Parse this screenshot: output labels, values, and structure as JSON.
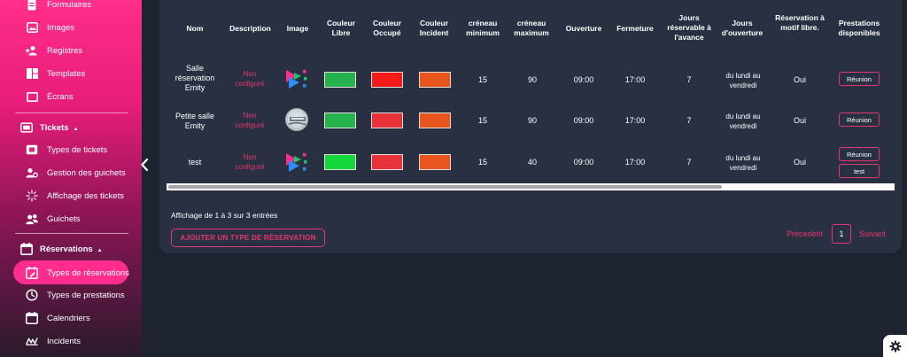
{
  "sidebar": {
    "items": [
      {
        "label": "Formulaires",
        "icon": "document-icon"
      },
      {
        "label": "Images",
        "icon": "image-icon"
      },
      {
        "label": "Registres",
        "icon": "user-add-icon"
      },
      {
        "label": "Templates",
        "icon": "grid-icon"
      },
      {
        "label": "Écrans",
        "icon": "screen-icon"
      }
    ],
    "tickets_section": {
      "label": "Tickets",
      "icon": "ticket-icon"
    },
    "tickets_items": [
      {
        "label": "Types de tickets",
        "icon": "ticket-icon"
      },
      {
        "label": "Gestion des guichets",
        "icon": "users-gear-icon"
      },
      {
        "label": "Affichage des tickets",
        "icon": "sparkle-icon"
      },
      {
        "label": "Guichets",
        "icon": "users-icon"
      }
    ],
    "reservations_section": {
      "label": "Réservations",
      "icon": "calendar-icon"
    },
    "reservations_items": [
      {
        "label": "Types de réservations",
        "icon": "calendar-edit-icon",
        "active": true
      },
      {
        "label": "Types de prestations",
        "icon": "clock-icon"
      },
      {
        "label": "Calendriers",
        "icon": "calendar-icon"
      },
      {
        "label": "Incidents",
        "icon": "incident-icon"
      }
    ]
  },
  "table": {
    "headers": {
      "nom": "Nom",
      "description": "Description",
      "image": "Image",
      "couleur_libre": "Couleur Libre",
      "couleur_occupe": "Couleur Occupé",
      "couleur_incident": "Couleur Incident",
      "creneau_min": "créneau minimum",
      "creneau_max": "créneau maximum",
      "ouverture": "Ouverture",
      "fermeture": "Fermeture",
      "jours_reservable": "Jours réservable à l'avance",
      "jours_ouverture": "Jours d'ouverture",
      "reservation_motif": "Réservation à motif libre.",
      "prestations": "Prestations disponibles"
    },
    "rows": [
      {
        "nom": "Salle réservation Emity",
        "description": "Non configuré",
        "image": "emity-logo",
        "color_libre": "#25b34e",
        "color_occupe": "#f51b1b",
        "color_incident": "#e8561d",
        "min": "15",
        "max": "90",
        "ouverture": "09:00",
        "fermeture": "17:00",
        "jours_avance": "7",
        "jours_ouverture": "du lundi au vendredi",
        "motif": "Oui",
        "prestations": [
          "Réunion"
        ]
      },
      {
        "nom": "Petite salle Emity",
        "description": "Non configuré",
        "image": "photo-avatar",
        "color_libre": "#25b34e",
        "color_occupe": "#e8323a",
        "color_incident": "#e8561d",
        "min": "15",
        "max": "90",
        "ouverture": "09:00",
        "fermeture": "17:00",
        "jours_avance": "7",
        "jours_ouverture": "du lundi au vendredi",
        "motif": "Oui",
        "prestations": [
          "Réunion"
        ]
      },
      {
        "nom": "test",
        "description": "Non configuré",
        "image": "emity-logo",
        "color_libre": "#14d73a",
        "color_occupe": "#e8323a",
        "color_incident": "#e8561d",
        "min": "15",
        "max": "40",
        "ouverture": "09:00",
        "fermeture": "17:00",
        "jours_avance": "7",
        "jours_ouverture": "du lundi au vendredi",
        "motif": "Oui",
        "prestations": [
          "Réunion",
          "test"
        ]
      }
    ]
  },
  "footer": {
    "entries_text": "Affichage de 1 à 3 sur 3 entrées",
    "add_button": "AJOUTER UN TYPE DE RÉSERVATION",
    "prev": "Précédent",
    "page": "1",
    "next": "Suivant"
  },
  "colors": {
    "accent": "#e8356f",
    "panel": "#283041",
    "background": "#1d2330"
  }
}
